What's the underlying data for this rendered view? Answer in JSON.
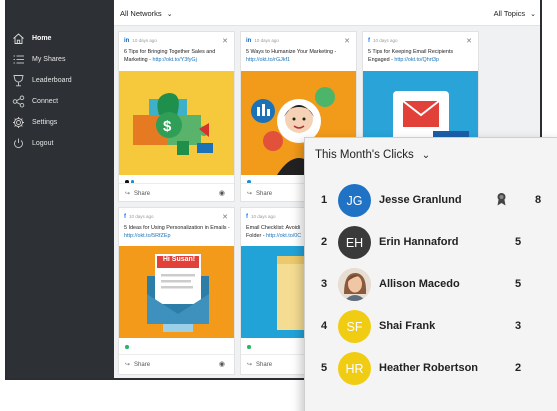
{
  "sidebar": {
    "items": [
      {
        "label": "Home",
        "icon": "home-icon"
      },
      {
        "label": "My Shares",
        "icon": "list-icon"
      },
      {
        "label": "Leaderboard",
        "icon": "trophy-icon"
      },
      {
        "label": "Connect",
        "icon": "share-nodes-icon"
      },
      {
        "label": "Settings",
        "icon": "gear-icon"
      },
      {
        "label": "Logout",
        "icon": "power-icon"
      }
    ]
  },
  "topbar": {
    "networks_label": "All Networks",
    "topics_label": "All Topics"
  },
  "cards": [
    {
      "network": "in",
      "time": "10 days ago",
      "title": "6 Tips for Bringing Together Sales and Marketing - ",
      "link": "http://okt.to/Y3fyGj",
      "share": "Share"
    },
    {
      "network": "in",
      "time": "10 days ago",
      "title": "5 Ways to Humanize Your Marketing - ",
      "link": "http://okt.to/rGJkf1",
      "share": "Share"
    },
    {
      "network": "f",
      "time": "10 days ago",
      "title": "5 Tips for Keeping Email Recipients Engaged - ",
      "link": "http://okt.to/Qhrt3p",
      "share": "Share"
    },
    {
      "network": "f",
      "time": "10 days ago",
      "title": "5 Ideas for Using Personalization in Emails - ",
      "link": "http://okt.to/5RfZEp",
      "share": "Share",
      "art_text": "Hi Susan!"
    },
    {
      "network": "f",
      "time": "10 days ago",
      "title": "Email Checklist: Avoidi",
      "title2": "Folder - ",
      "link": "http://okt.to/0C",
      "share": "Share"
    }
  ],
  "leaderboard": {
    "title": "This Month's Clicks",
    "rows": [
      {
        "rank": "1",
        "initials": "JG",
        "name": "Jesse Granlund",
        "clicks": "8",
        "color": "#1f72c4",
        "award": true
      },
      {
        "rank": "2",
        "initials": "EH",
        "name": "Erin Hannaford",
        "clicks": "5",
        "color": "#3a3a3a"
      },
      {
        "rank": "3",
        "initials": "",
        "name": "Allison Macedo",
        "clicks": "5",
        "color": "#c89a7a",
        "photo": true
      },
      {
        "rank": "4",
        "initials": "SF",
        "name": "Shai Frank",
        "clicks": "3",
        "color": "#f0cc12"
      },
      {
        "rank": "5",
        "initials": "HR",
        "name": "Heather Robertson",
        "clicks": "2",
        "color": "#f0cc12"
      }
    ]
  },
  "colors": {
    "sidebar": "#2d3034",
    "link": "#1a73b8",
    "dot_blue": "#1c8fce"
  }
}
